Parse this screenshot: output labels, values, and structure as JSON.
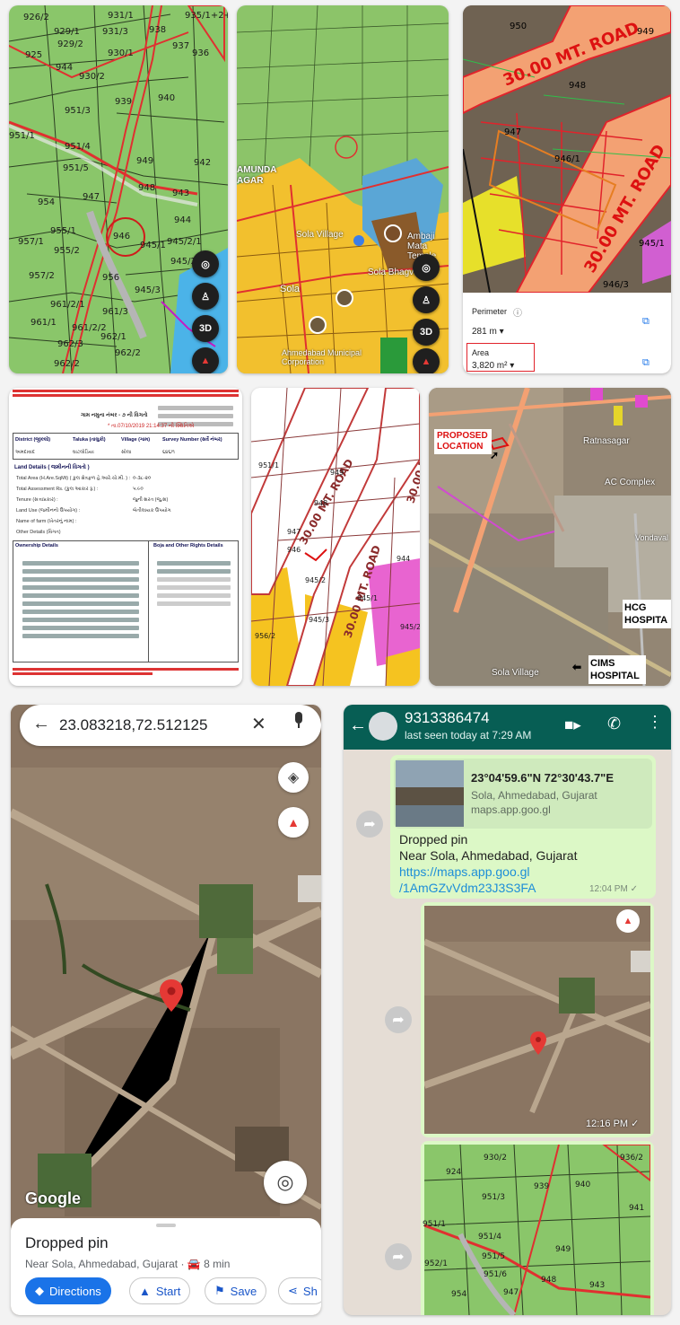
{
  "tile1": {
    "plots": [
      "926/2",
      "931/1",
      "935/1+2+3",
      "929/1",
      "929/2",
      "931/3",
      "938",
      "925",
      "930/1",
      "937",
      "930/2",
      "936",
      "944",
      "939",
      "940",
      "951/3",
      "951/1",
      "951/4",
      "949",
      "942",
      "951/5",
      "947",
      "948",
      "943",
      "954",
      "944",
      "955/1",
      "946",
      "945/1",
      "945/2/1",
      "957/1",
      "955/2",
      "945/2",
      "957/2",
      "956",
      "945/3",
      "961/2/1",
      "961/1",
      "961/2/2",
      "961/3",
      "962/1",
      "962/3",
      "962/2",
      "962/2"
    ],
    "btn_3d": "3D"
  },
  "tile2": {
    "labels": [
      "AMUNDA",
      "AGAR",
      "Sola Village",
      "Ambaji Mata Temple",
      "Sola",
      "Sola Bhagvat",
      "Ahmedabad Municipal Corporation"
    ],
    "btn_3d": "3D"
  },
  "tile3": {
    "road_labels": [
      "30.00 MT. ROAD",
      "30.00 MT. ROAD"
    ],
    "plots": [
      "950",
      "949",
      "948",
      "947",
      "946/1",
      "945/1",
      "946/3"
    ],
    "perimeter_label": "Perimeter",
    "perimeter_value": "281 m",
    "area_label": "Area",
    "area_value": "3,820 m²"
  },
  "tile4": {
    "title": "ગામ નમુના નંબર - ૭ ની વિગતો",
    "date": "* તા.07/10/2019 21:14:37 ની સ્થિતિએ",
    "headers": [
      "District (જીલ્લો)",
      "Taluka (તાલુકો)",
      "Village (ગામ)",
      "Survey Number (સર્વે નંબર)"
    ],
    "values": [
      "અમદાવાદ",
      "ઘાટલોડિયા",
      "સોલા",
      "૬૪૬/૧"
    ],
    "land_details": "Land Details ( જમીનની વિગતો )",
    "rows": [
      "Total Area (H.Are.SqMt) ( કુલ ક્ષેત્રફળ હે.આરે.ચો.મી. ) :",
      "Total Assessment Rs. (કુલ આકાર રૂ.) :",
      "Tenure (સત્તાપ્રકાર) :",
      "Land Use (જમીનનો ઉપયોગ) :",
      "Name of farm (ખેતરનું નામ) :",
      "Other Details (વિગત)"
    ],
    "row_values": [
      "૦-૩૮-૨૦",
      "૫.૯૦",
      "જુની શરત (જુ.શ)",
      "બેતીલાયક ઉપયોગ",
      "",
      ""
    ],
    "ownership": "Ownership Details",
    "boja": "Boja and Other Rights Details"
  },
  "tile5": {
    "road_labels": [
      "30.00 MT. ROAD",
      "30.00 MT. ROAD",
      "30.00 MT. ROAD"
    ],
    "plots": [
      "949",
      "948",
      "947",
      "946",
      "951/1",
      "945/1",
      "944",
      "945/2",
      "945/3",
      "956/2",
      "945/2"
    ]
  },
  "tile6": {
    "proposed": "PROPOSED LOCATION",
    "ratnasagar": "Ratnasagar",
    "ac_complex": "AC Complex",
    "hcg": "HCG HOSPITA",
    "cims": "CIMS HOSPITAL",
    "sola_village": "Sola Village",
    "vondaval": "Vondaval"
  },
  "maps": {
    "search_value": "23.083218,72.512125",
    "google": "Google",
    "place_title": "Dropped pin",
    "place_sub": "Near Sola, Ahmedabad, Gujarat",
    "drive_time": "8 min",
    "directions": "Directions",
    "start": "Start",
    "save": "Save",
    "share": "Sh"
  },
  "whatsapp": {
    "contact": "9313386474",
    "last_seen": "last seen today at 7:29 AM",
    "coords": "23°04'59.6\"N 72°30'43.7\"E",
    "location": "Sola, Ahmedabad, Gujarat",
    "domain": "maps.app.goo.gl",
    "msg_line1": "Dropped pin",
    "msg_line2": "Near Sola, Ahmedabad, Gujarat",
    "link1": "https://maps.app.goo.gl",
    "link2": "/1AmGZvVdm23J3S3FA",
    "time1": "12:04 PM",
    "time2": "12:16 PM",
    "plots": [
      "930/2",
      "936/2",
      "924",
      "939",
      "940",
      "951/3",
      "941",
      "951/1",
      "951/4",
      "949",
      "951/5",
      "952/1",
      "951/6",
      "948",
      "954",
      "947",
      "943"
    ]
  },
  "colors": {
    "map_green": "#8cc469",
    "road_orange": "#f3a173",
    "road_red": "#e1232b",
    "wa_green": "#075e54",
    "wa_bubble": "#dcf8c6",
    "gmaps_blue": "#1a73e8",
    "pin_red": "#e53935"
  }
}
